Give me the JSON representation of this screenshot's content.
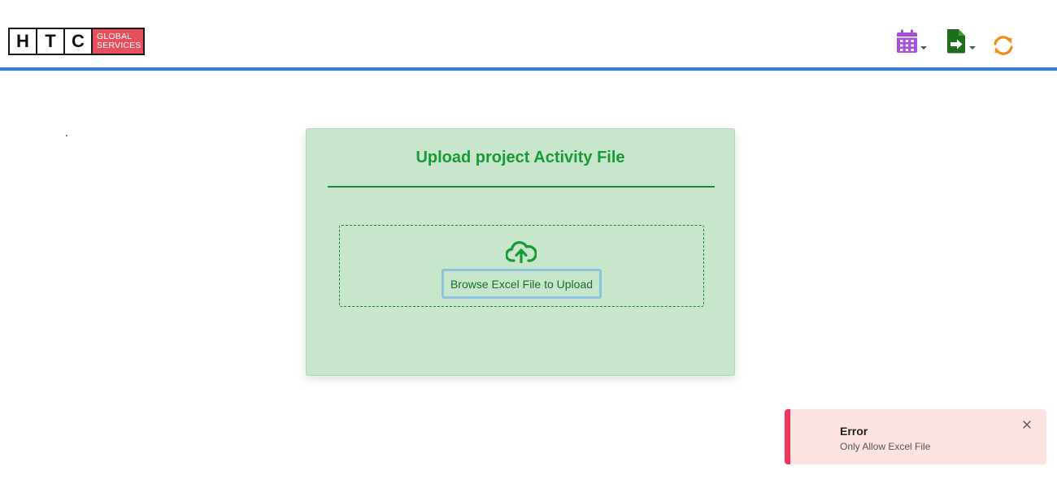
{
  "header": {
    "logo": {
      "letters": [
        "H",
        "T",
        "C"
      ],
      "global_line1": "GLOBAL",
      "global_line2": "SERVICES",
      "brand_color": "#e6505c"
    },
    "icons": [
      {
        "name": "calendar-icon",
        "color": "#a84fd9",
        "has_dropdown": true
      },
      {
        "name": "export-file-icon",
        "color": "#1f6e1f",
        "has_dropdown": true
      },
      {
        "name": "refresh-icon",
        "color": "#f28a1d",
        "has_dropdown": false
      }
    ],
    "rule_color": "#2f7de1"
  },
  "upload_card": {
    "title": "Upload project Activity File",
    "upload_icon": "cloud-upload-icon",
    "browse_button_label": "Browse Excel File to Upload",
    "background_color": "#c8e6cc",
    "accent_color": "#189a38"
  },
  "toast": {
    "type": "error",
    "title": "Error",
    "message": "Only Allow Excel File",
    "accent_color": "#f2335c",
    "close_icon": "close-icon"
  }
}
